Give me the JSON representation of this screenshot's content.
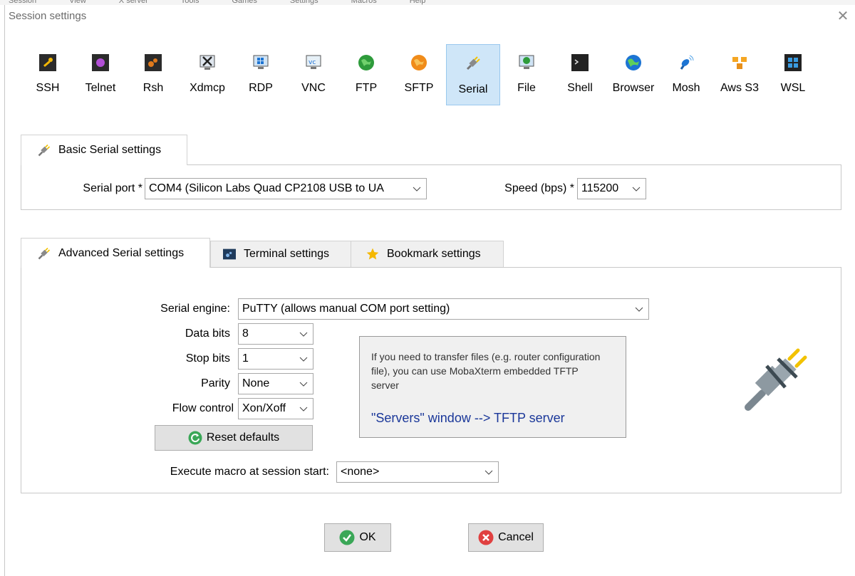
{
  "window": {
    "title": "Session settings",
    "close_label": "✕"
  },
  "session_types": [
    {
      "label": "SSH",
      "icon": "ssh-icon"
    },
    {
      "label": "Telnet",
      "icon": "telnet-icon"
    },
    {
      "label": "Rsh",
      "icon": "rsh-icon"
    },
    {
      "label": "Xdmcp",
      "icon": "xdmcp-icon"
    },
    {
      "label": "RDP",
      "icon": "rdp-icon"
    },
    {
      "label": "VNC",
      "icon": "vnc-icon"
    },
    {
      "label": "FTP",
      "icon": "ftp-icon"
    },
    {
      "label": "SFTP",
      "icon": "sftp-icon"
    },
    {
      "label": "Serial",
      "icon": "serial-plug-icon",
      "selected": true
    },
    {
      "label": "File",
      "icon": "file-icon"
    },
    {
      "label": "Shell",
      "icon": "shell-icon"
    },
    {
      "label": "Browser",
      "icon": "browser-icon"
    },
    {
      "label": "Mosh",
      "icon": "mosh-icon"
    },
    {
      "label": "Aws S3",
      "icon": "aws-s3-icon"
    },
    {
      "label": "WSL",
      "icon": "wsl-icon"
    }
  ],
  "basic": {
    "tab_label": "Basic Serial settings",
    "serial_port_label": "Serial port *",
    "serial_port_value": "COM4  (Silicon Labs Quad CP2108 USB to UA",
    "speed_label": "Speed (bps) *",
    "speed_value": "115200"
  },
  "advanced_tabs": [
    {
      "label": "Advanced Serial settings",
      "icon": "serial-plug-icon",
      "active": true
    },
    {
      "label": "Terminal settings",
      "icon": "terminal-icon"
    },
    {
      "label": "Bookmark settings",
      "icon": "star-icon"
    }
  ],
  "advanced": {
    "engine_label": "Serial engine:",
    "engine_value": "PuTTY    (allows manual COM port setting)",
    "data_bits_label": "Data bits",
    "data_bits_value": "8",
    "stop_bits_label": "Stop bits",
    "stop_bits_value": "1",
    "parity_label": "Parity",
    "parity_value": "None",
    "flow_label": "Flow control",
    "flow_value": "Xon/Xoff",
    "reset_label": "Reset defaults",
    "macro_label": "Execute macro at session start:",
    "macro_value": "<none>",
    "info_text": "If you need to transfer files (e.g. router configuration file), you can use MobaXterm embedded TFTP server",
    "info_link": "\"Servers\" window  -->  TFTP server"
  },
  "buttons": {
    "ok": "OK",
    "cancel": "Cancel"
  },
  "colors": {
    "selected_bg": "#cfe6f8",
    "link": "#1a3799",
    "ok_green": "#3aa757",
    "cancel_red": "#e04040"
  }
}
